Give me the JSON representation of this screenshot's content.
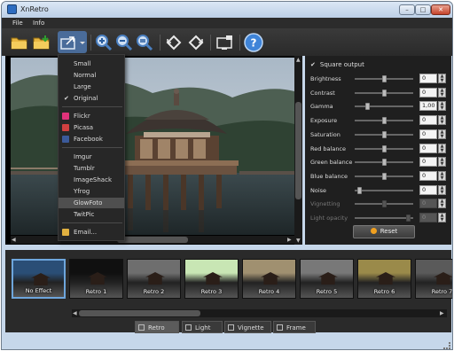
{
  "window": {
    "title": "XnRetro",
    "min_label": "–",
    "max_label": "□",
    "close_label": "✕"
  },
  "menu": {
    "file": "File",
    "info": "Info"
  },
  "toolbar": {
    "buttons": [
      "open-folder",
      "save",
      "share",
      "zoom-in",
      "zoom-out",
      "zoom-fit",
      "rotate-left",
      "rotate-right",
      "wallpaper",
      "help"
    ]
  },
  "share_menu": {
    "sizes": [
      {
        "label": "Small",
        "checked": false
      },
      {
        "label": "Normal",
        "checked": false
      },
      {
        "label": "Large",
        "checked": false
      },
      {
        "label": "Original",
        "checked": true
      }
    ],
    "services": [
      "Flickr",
      "Picasa",
      "Facebook"
    ],
    "uploads": [
      "Imgur",
      "Tumblr",
      "ImageShack",
      "Yfrog",
      "GlowFoto",
      "TwitPic"
    ],
    "highlighted": "GlowFoto",
    "email": "Email..."
  },
  "adjust": {
    "square_output": "Square output",
    "square_checked": true,
    "rows": [
      {
        "label": "Brightness",
        "value": "0",
        "level": 0.5,
        "enabled": true
      },
      {
        "label": "Contrast",
        "value": "0",
        "level": 0.5,
        "enabled": true
      },
      {
        "label": "Gamma",
        "value": "1,00",
        "level": 0.2,
        "enabled": true
      },
      {
        "label": "Exposure",
        "value": "0",
        "level": 0.5,
        "enabled": true
      },
      {
        "label": "Saturation",
        "value": "0",
        "level": 0.5,
        "enabled": true
      },
      {
        "label": "Red balance",
        "value": "0",
        "level": 0.5,
        "enabled": true
      },
      {
        "label": "Green balance",
        "value": "0",
        "level": 0.5,
        "enabled": true
      },
      {
        "label": "Blue balance",
        "value": "0",
        "level": 0.5,
        "enabled": true
      },
      {
        "label": "Noise",
        "value": "0",
        "level": 0.05,
        "enabled": true
      },
      {
        "label": "Vignetting",
        "value": "0",
        "level": 0.5,
        "enabled": false
      },
      {
        "label": "Light opacity",
        "value": "0",
        "level": 0.95,
        "enabled": false
      }
    ],
    "reset": "Reset"
  },
  "effects": [
    {
      "label": "No Effect",
      "selected": true,
      "tint": "#2a4e76"
    },
    {
      "label": "Retro 1",
      "selected": false,
      "tint": "#101010"
    },
    {
      "label": "Retro 2",
      "selected": false,
      "tint": "#6e6e6e"
    },
    {
      "label": "Retro 3",
      "selected": false,
      "tint": "#c8e6b4"
    },
    {
      "label": "Retro 4",
      "selected": false,
      "tint": "#a09070"
    },
    {
      "label": "Retro 5",
      "selected": false,
      "tint": "#787878"
    },
    {
      "label": "Retro 6",
      "selected": false,
      "tint": "#9a8a4a"
    },
    {
      "label": "Retro 7",
      "selected": false,
      "tint": "#5a5a5a"
    }
  ],
  "tabs": [
    {
      "label": "Retro",
      "selected": true
    },
    {
      "label": "Light",
      "selected": false
    },
    {
      "label": "Vignette",
      "selected": false
    },
    {
      "label": "Frame",
      "selected": false
    }
  ]
}
